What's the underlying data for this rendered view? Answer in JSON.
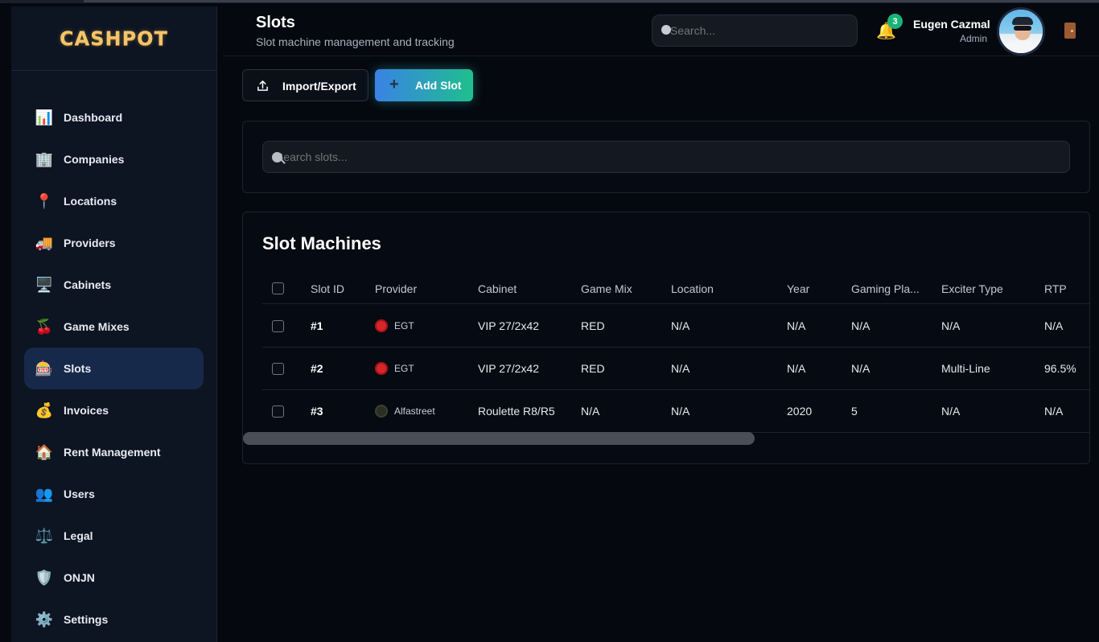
{
  "app": {
    "logo": "CASHPOT"
  },
  "sidebar": {
    "items": [
      {
        "label": "Dashboard",
        "icon": "📊",
        "icon_name": "chart-icon"
      },
      {
        "label": "Companies",
        "icon": "🏢",
        "icon_name": "building-icon"
      },
      {
        "label": "Locations",
        "icon": "📍",
        "icon_name": "pin-icon"
      },
      {
        "label": "Providers",
        "icon": "🚚",
        "icon_name": "truck-icon"
      },
      {
        "label": "Cabinets",
        "icon": "🖥️",
        "icon_name": "monitor-icon"
      },
      {
        "label": "Game Mixes",
        "icon": "🍒",
        "icon_name": "cherry-icon"
      },
      {
        "label": "Slots",
        "icon": "🎰",
        "icon_name": "slot-machine-icon",
        "active": true
      },
      {
        "label": "Invoices",
        "icon": "💰",
        "icon_name": "money-bag-icon"
      },
      {
        "label": "Rent Management",
        "icon": "🏠",
        "icon_name": "house-icon"
      },
      {
        "label": "Users",
        "icon": "👥",
        "icon_name": "users-icon"
      },
      {
        "label": "Legal",
        "icon": "⚖️",
        "icon_name": "scales-icon"
      },
      {
        "label": "ONJN",
        "icon": "🛡️",
        "icon_name": "shield-icon"
      },
      {
        "label": "Settings",
        "icon": "⚙️",
        "icon_name": "gear-icon"
      }
    ],
    "active_color": "#17294a"
  },
  "header": {
    "title": "Slots",
    "subtitle": "Slot machine management and tracking",
    "search_placeholder": "Search...",
    "notifications_count": "3",
    "user_name": "Eugen Cazmal",
    "user_role": "Admin"
  },
  "toolbar": {
    "import_label": "Import/Export",
    "add_label": "Add Slot",
    "add_plus": "+"
  },
  "filter": {
    "search_placeholder": "Search slots..."
  },
  "table": {
    "title": "Slot Machines",
    "columns": [
      "Slot ID",
      "Provider",
      "Cabinet",
      "Game Mix",
      "Location",
      "Year",
      "Gaming Pla...",
      "Exciter Type",
      "RTP"
    ],
    "rows": [
      {
        "id": "#1",
        "provider": "EGT",
        "cabinet": "VIP 27/2x42",
        "game_mix": "RED",
        "location": "N/A",
        "year": "N/A",
        "gaming_places": "N/A",
        "exciter": "N/A",
        "rtp": "N/A"
      },
      {
        "id": "#2",
        "provider": "EGT",
        "cabinet": "VIP 27/2x42",
        "game_mix": "RED",
        "location": "N/A",
        "year": "N/A",
        "gaming_places": "N/A",
        "exciter": "Multi-Line",
        "rtp": "96.5%"
      },
      {
        "id": "#3",
        "provider": "Alfastreet",
        "cabinet": "Roulette R8/R5",
        "game_mix": "N/A",
        "location": "N/A",
        "year": "2020",
        "gaming_places": "5",
        "exciter": "N/A",
        "rtp": "N/A"
      }
    ]
  },
  "colors": {
    "accent_start": "#3a82e6",
    "accent_end": "#1fbf8e",
    "badge": "#19b37a",
    "logo": "#f3c56b"
  }
}
